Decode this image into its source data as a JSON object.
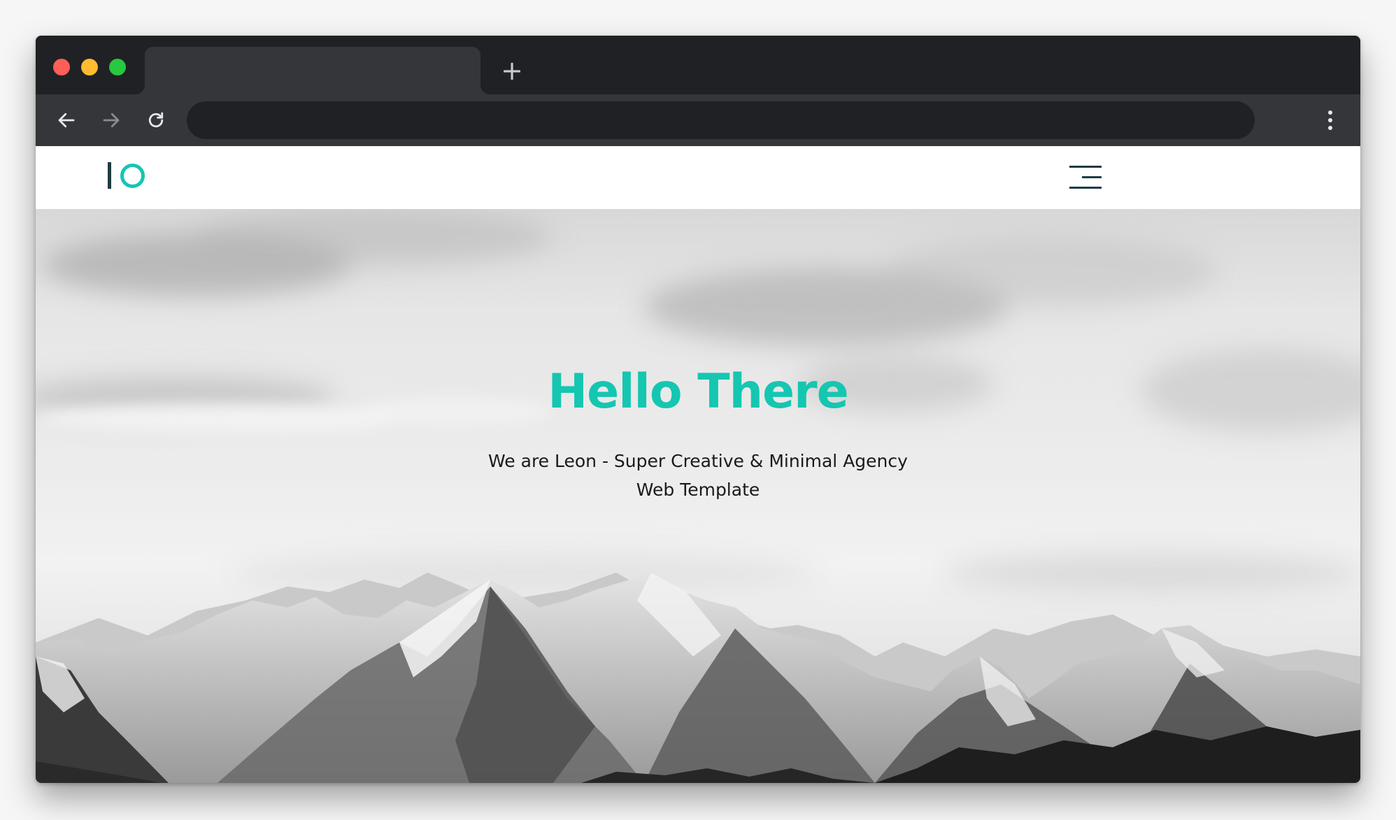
{
  "browser": {
    "new_tab_label": "+",
    "tab_title": "",
    "address": ""
  },
  "site": {
    "logo": "IO",
    "menu_icon": "hamburger-menu-icon",
    "accent_color": "#15c6b1"
  },
  "hero": {
    "title": "Hello There",
    "subtitle": "We are Leon - Super Creative & Minimal Agency Web Template"
  }
}
